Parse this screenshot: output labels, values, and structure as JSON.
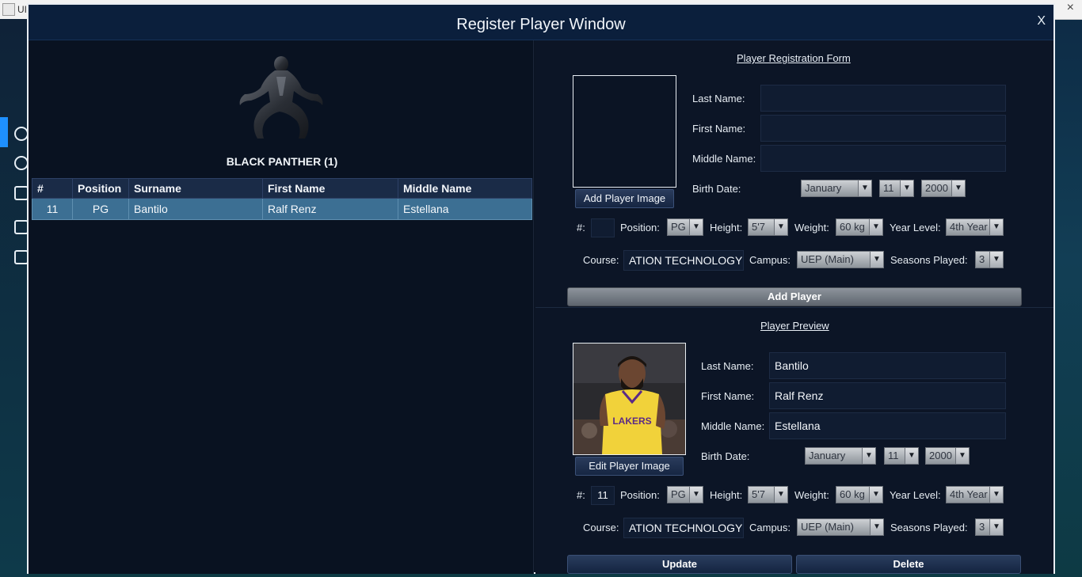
{
  "background_app": {
    "title": "UI"
  },
  "window": {
    "title": "Register Player Window",
    "close_label": "X"
  },
  "team": {
    "name": "BLACK PANTHER (1)"
  },
  "table": {
    "columns": [
      "#",
      "Position",
      "Surname",
      "First Name",
      "Middle Name"
    ],
    "rows": [
      {
        "number": "11",
        "position": "PG",
        "surname": "Bantilo",
        "first_name": "Ralf Renz",
        "middle_name": "Estellana"
      }
    ]
  },
  "registration_form": {
    "title": "Player Registration Form",
    "labels": {
      "last_name": "Last Name:",
      "first_name": "First Name:",
      "middle_name": "Middle Name:",
      "birth_date": "Birth Date:",
      "number": "#:",
      "position": "Position:",
      "height": "Height:",
      "weight": "Weight:",
      "year_level": "Year Level:",
      "course": "Course:",
      "campus": "Campus:",
      "seasons_played": "Seasons Played:"
    },
    "values": {
      "last_name": "",
      "first_name": "",
      "middle_name": "",
      "birth_month": "January",
      "birth_day": "11",
      "birth_year": "2000",
      "number": "",
      "position": "PG",
      "height": "5'7",
      "weight": "60 kg",
      "year_level": "4th Year",
      "course": "ATION TECHNOLOGY",
      "campus": "UEP (Main)",
      "seasons_played": "3"
    },
    "add_image_button": "Add Player Image",
    "submit_button": "Add Player"
  },
  "preview": {
    "title": "Player Preview",
    "labels": {
      "last_name": "Last Name:",
      "first_name": "First Name:",
      "middle_name": "Middle Name:",
      "birth_date": "Birth Date:",
      "number": "#:",
      "position": "Position:",
      "height": "Height:",
      "weight": "Weight:",
      "year_level": "Year Level:",
      "course": "Course:",
      "campus": "Campus:",
      "seasons_played": "Seasons Played:"
    },
    "values": {
      "last_name": "Bantilo",
      "first_name": "Ralf Renz",
      "middle_name": "Estellana",
      "birth_month": "January",
      "birth_day": "11",
      "birth_year": "2000",
      "number": "11",
      "position": "PG",
      "height": "5'7",
      "weight": "60 kg",
      "year_level": "4th Year",
      "course": "ATION TECHNOLOGY",
      "campus": "UEP (Main)",
      "seasons_played": "3"
    },
    "jersey_text": "LAKERS",
    "edit_image_button": "Edit Player Image",
    "update_button": "Update",
    "delete_button": "Delete"
  }
}
